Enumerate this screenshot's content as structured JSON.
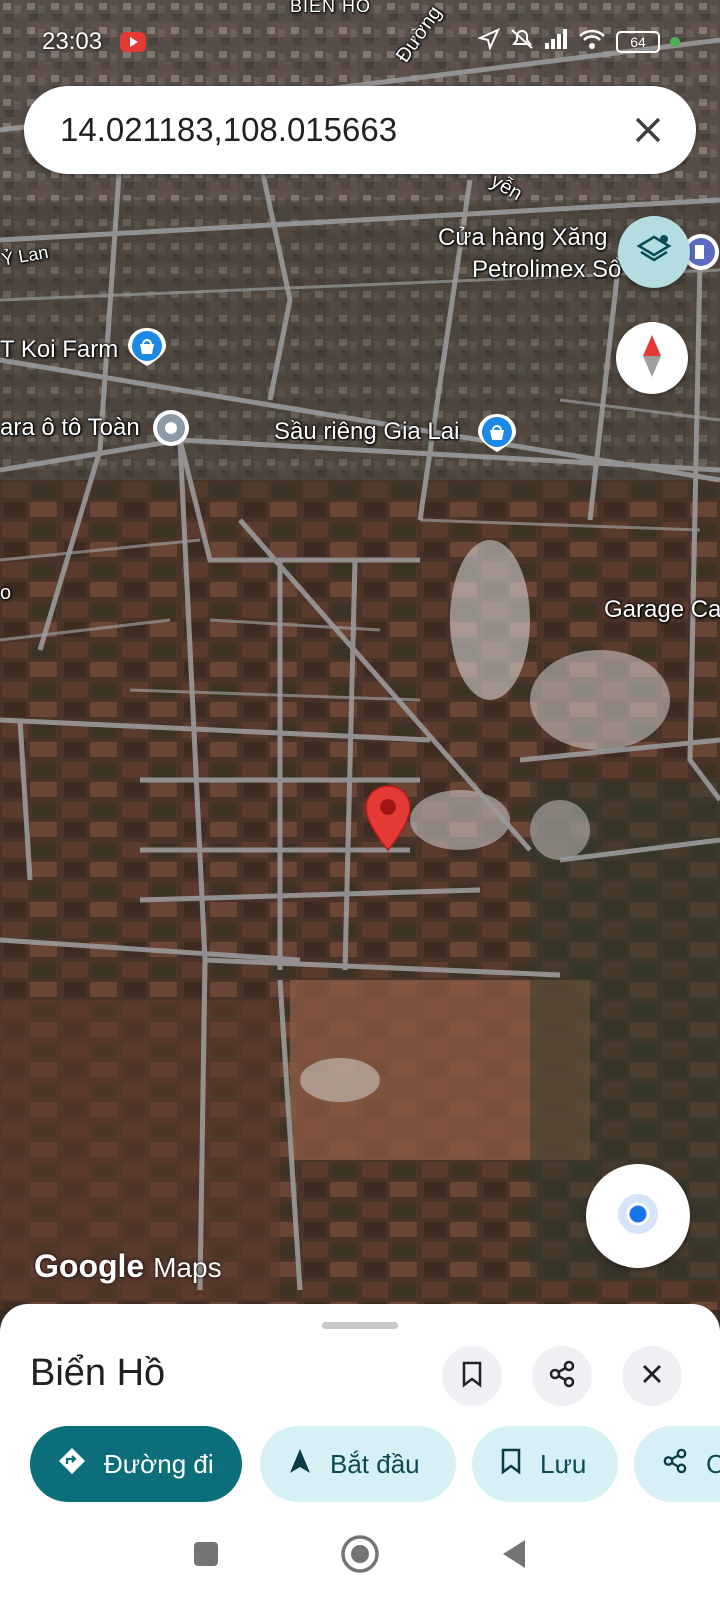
{
  "status": {
    "time": "23:03",
    "battery": "64"
  },
  "search": {
    "value": "14.021183,108.015663"
  },
  "map_labels": {
    "top_area": "BIỂN HỒ",
    "road_top": "Đường",
    "road_right": "yễn",
    "y_lan": "Ỷ Lan",
    "koi_farm": "T Koi Farm",
    "gara": "ara ô tô Toàn",
    "sau_rieng": "Sầu riêng Gia Lai",
    "gas_station_1": "Cửa hàng Xăng",
    "gas_station_2": "Petrolimex Sổ",
    "garage": "Garage Ca",
    "edge_p": "o"
  },
  "branding": {
    "google": "Google",
    "maps": "Maps"
  },
  "sheet": {
    "title": "Biển Hồ",
    "chips": {
      "directions": "Đường đi",
      "start": "Bắt đầu",
      "save": "Lưu",
      "share": "C"
    }
  },
  "icons": {
    "status": [
      "youtube-icon",
      "location-arrow-icon",
      "mute-icon",
      "signal-icon",
      "wifi-icon",
      "battery-icon",
      "dot-icon"
    ],
    "map": [
      "layers-icon",
      "compass-icon",
      "my-location-icon",
      "red-pin-icon",
      "shopping-pin-icon"
    ],
    "sheet": [
      "bookmark-icon",
      "share-icon",
      "close-icon",
      "directions-icon",
      "navigate-arrow-icon"
    ]
  },
  "colors": {
    "accent": "#0b6e7a",
    "chip": "#d7f0f6",
    "pin": "#e53935",
    "poi": "#1e88e5"
  }
}
